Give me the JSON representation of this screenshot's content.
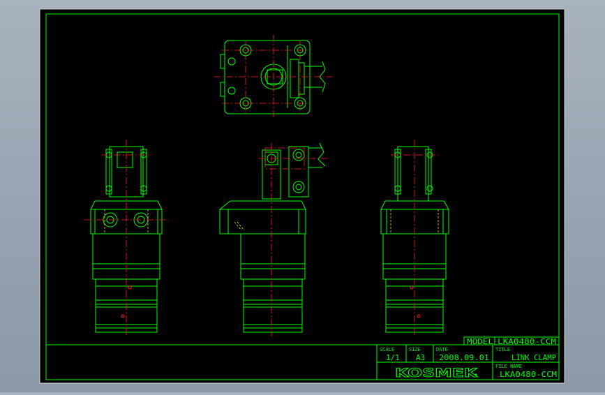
{
  "drawing": {
    "colors": {
      "viewport_bg": "#a9b3bf",
      "sheet_bg": "#000000",
      "line": "#00ff00",
      "centerline": "#ff2020",
      "hidden": "#ffff00"
    },
    "title_block": {
      "model_label": "MODEL",
      "model_value": "LKA0480-CCM",
      "scale_label": "SCALE",
      "scale_value": "1/1",
      "size_label": "SIZE",
      "size_value": "A3",
      "date_label": "DATE",
      "date_value": "2008.09.01",
      "title_label": "TITLE",
      "title_value": "LINK CLAMP",
      "filename_label": "FILE NAME",
      "filename_value": "LKA0480-CCM",
      "brand": "KOSMEK"
    }
  }
}
